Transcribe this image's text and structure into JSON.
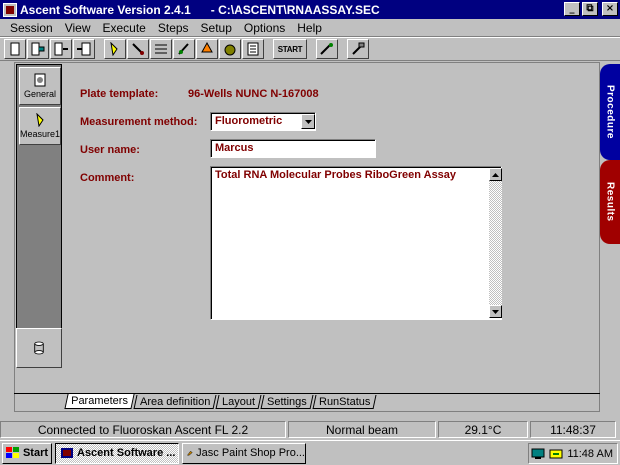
{
  "window": {
    "title": "Ascent Software Version 2.4.1      - C:\\ASCENT\\RNAASSAY.SEC",
    "min_label": "_",
    "max_label": "⧉",
    "close_label": "×"
  },
  "menu": [
    "Session",
    "View",
    "Execute",
    "Steps",
    "Setup",
    "Options",
    "Help"
  ],
  "toolbar": {
    "start_label": "START"
  },
  "leftnav": {
    "general_label": "General",
    "measure_label": "Measure1"
  },
  "form": {
    "plate_template_label": "Plate template:",
    "plate_template_value": "96-Wells NUNC N-167008",
    "method_label": "Measurement method:",
    "method_value": "Fluorometric",
    "user_label": "User name:",
    "user_value": "Marcus",
    "comment_label": "Comment:",
    "comment_value": "Total RNA Molecular Probes RiboGreen Assay"
  },
  "side_tabs": {
    "procedure": "Procedure",
    "results": "Results",
    "procedure_color": "#0000a0",
    "results_color": "#a00000"
  },
  "tabs": [
    "Parameters",
    "Area definition",
    "Layout",
    "Settings",
    "RunStatus"
  ],
  "status": {
    "connection": "Connected to Fluoroskan Ascent FL 2.2",
    "beam": "Normal beam",
    "temperature": "29.1°C",
    "time": "11:48:37"
  },
  "taskbar": {
    "start": "Start",
    "task1": "Ascent Software ...",
    "task2": "Jasc Paint Shop Pro...",
    "clock": "11:48 AM"
  }
}
